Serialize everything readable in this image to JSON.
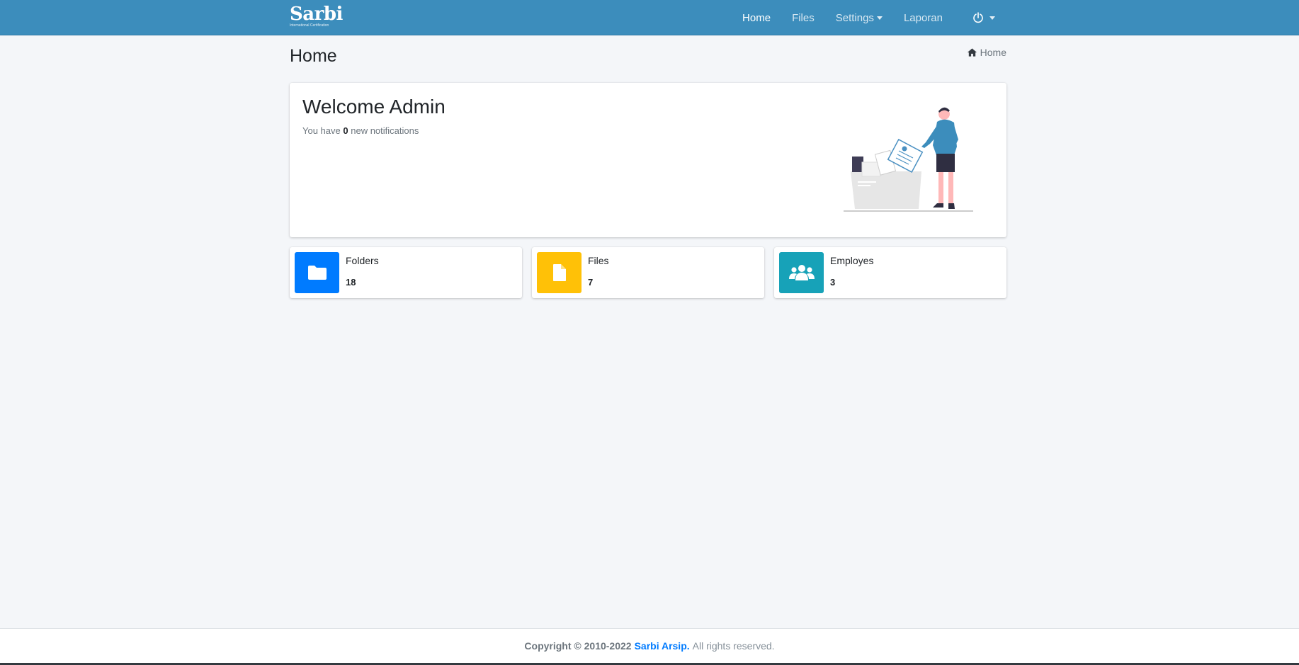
{
  "brand": {
    "name": "Sarbi",
    "tagline": "International Certification"
  },
  "nav": {
    "items": [
      {
        "label": "Home",
        "active": true
      },
      {
        "label": "Files"
      },
      {
        "label": "Settings",
        "dropdown": true
      },
      {
        "label": "Laporan"
      }
    ],
    "power_icon": "power-icon"
  },
  "page": {
    "title": "Home",
    "breadcrumb": "Home"
  },
  "welcome": {
    "heading": "Welcome Admin",
    "text_before": "You have",
    "count": "0",
    "text_after": "new notifications"
  },
  "stats": [
    {
      "label": "Folders",
      "value": "18",
      "icon": "folder-icon",
      "color": "#007bff"
    },
    {
      "label": "Files",
      "value": "7",
      "icon": "file-icon",
      "color": "#ffc107"
    },
    {
      "label": "Employes",
      "value": "3",
      "icon": "users-icon",
      "color": "#17a2b8"
    }
  ],
  "footer": {
    "copyright": "Copyright © 2010-2022",
    "link": "Sarbi Arsip.",
    "rights": "All rights reserved."
  },
  "colors": {
    "navbar": "#3c8dbc",
    "background": "#f4f6f9"
  }
}
